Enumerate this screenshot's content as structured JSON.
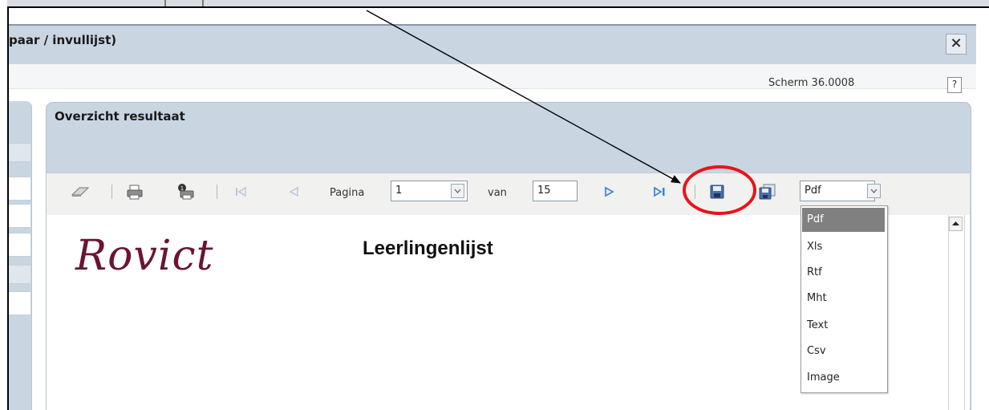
{
  "window": {
    "title": "paar / invullijst)",
    "close_icon": "×"
  },
  "info": {
    "screen_code": "Scherm 36.0008",
    "help_label": "?"
  },
  "panel": {
    "title": "Overzicht resultaat"
  },
  "toolbar": {
    "page_label": "Pagina",
    "page_value": "1",
    "of_label": "van",
    "total_pages": "15",
    "export_format": "Pdf"
  },
  "export_formats": {
    "options": [
      "Pdf",
      "Xls",
      "Rtf",
      "Mht",
      "Text",
      "Csv",
      "Image"
    ],
    "selected": "Pdf"
  },
  "report": {
    "logo_text": "Rovict",
    "title": "Leerlingenlijst"
  },
  "colors": {
    "accent_circle": "#e8141b",
    "logo": "#6b1433",
    "panel_bg": "#c9d6e2"
  }
}
